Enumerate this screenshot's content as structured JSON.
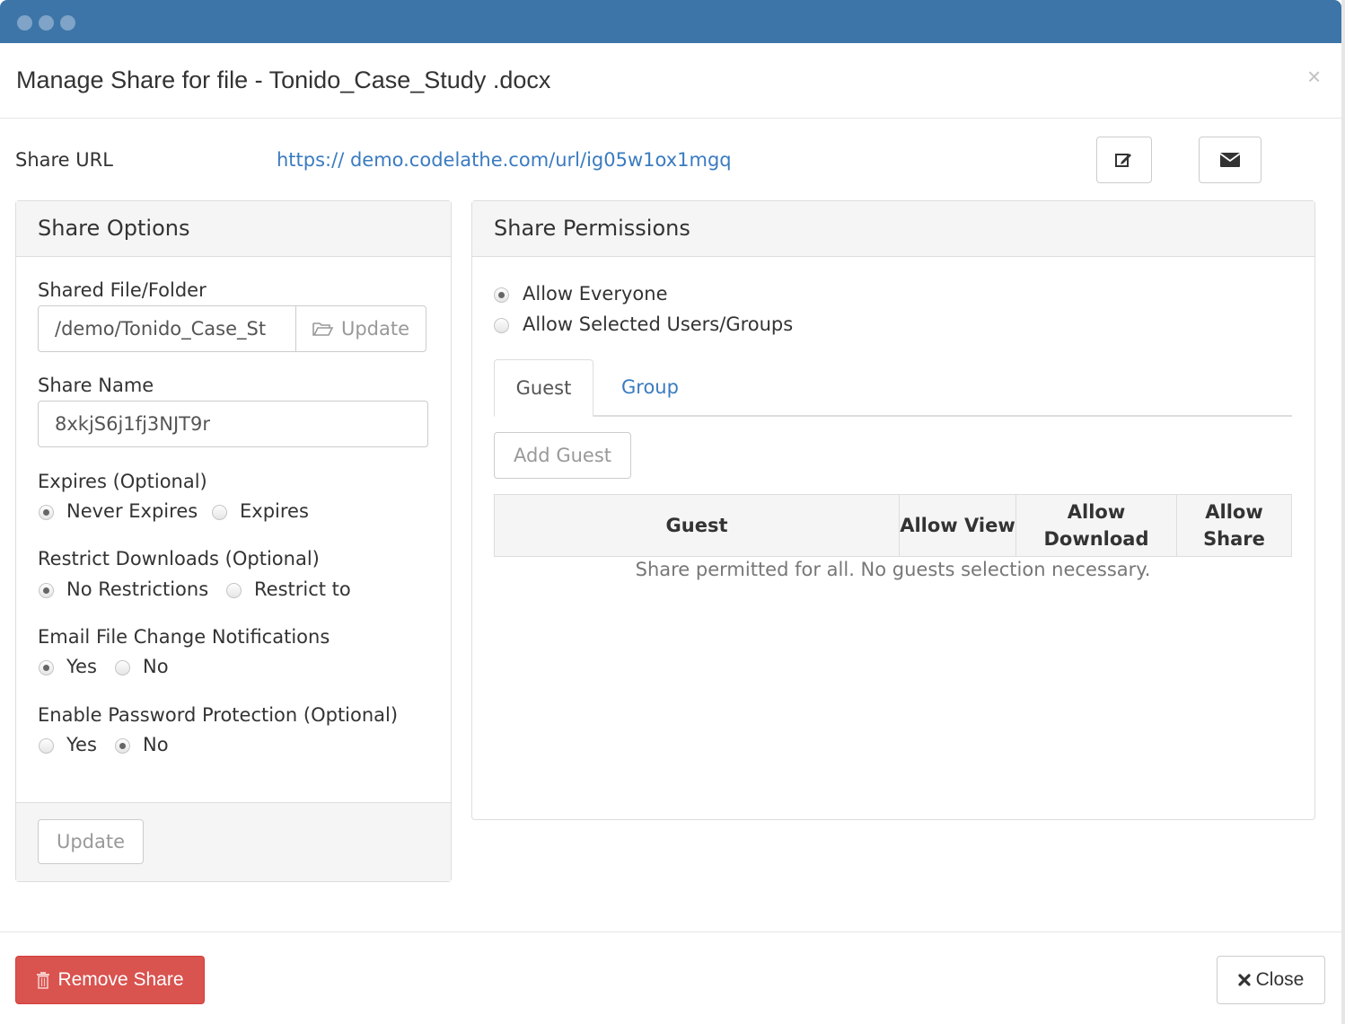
{
  "dialog": {
    "title": "Manage Share for file - Tonido_Case_Study .docx",
    "close_glyph": "×"
  },
  "share_url": {
    "label": "Share URL",
    "url": "https:// demo.codelathe.com/url/ig05w1ox1mgq",
    "edit_icon": "edit-icon",
    "email_icon": "envelope-icon"
  },
  "share_options": {
    "title": "Share Options",
    "shared_file_label": "Shared File/Folder",
    "shared_file_value": "/demo/Tonido_Case_St",
    "update_path_label": "Update",
    "share_name_label": "Share Name",
    "share_name_value": "8xkjS6j1fj3NJT9r",
    "expires_label": "Expires (Optional)",
    "expires_options": [
      "Never Expires",
      "Expires"
    ],
    "expires_selected": "Never Expires",
    "restrict_label": "Restrict Downloads (Optional)",
    "restrict_options": [
      "No Restrictions",
      "Restrict to"
    ],
    "restrict_selected": "No Restrictions",
    "email_label": "Email File Change Notifications",
    "email_options": [
      "Yes",
      "No"
    ],
    "email_selected": "Yes",
    "password_label": "Enable Password Protection (Optional)",
    "password_options": [
      "Yes",
      "No"
    ],
    "password_selected": "No",
    "update_button": "Update"
  },
  "share_permissions": {
    "title": "Share Permissions",
    "options": [
      "Allow Everyone",
      "Allow Selected Users/Groups"
    ],
    "selected": "Allow Everyone",
    "tabs": [
      "Guest",
      "Group"
    ],
    "active_tab": "Guest",
    "add_guest_button": "Add Guest",
    "table": {
      "headers": [
        "Guest",
        "Allow View",
        "Allow Download",
        "Allow Share"
      ],
      "empty_message": "Share permitted for all. No guests selection necessary."
    }
  },
  "footer": {
    "remove_share": "Remove Share",
    "close": "Close",
    "danger_color": "#d9534f"
  },
  "theme": {
    "titlebar_color": "#3d75a8",
    "link_color": "#3a7bc0"
  }
}
